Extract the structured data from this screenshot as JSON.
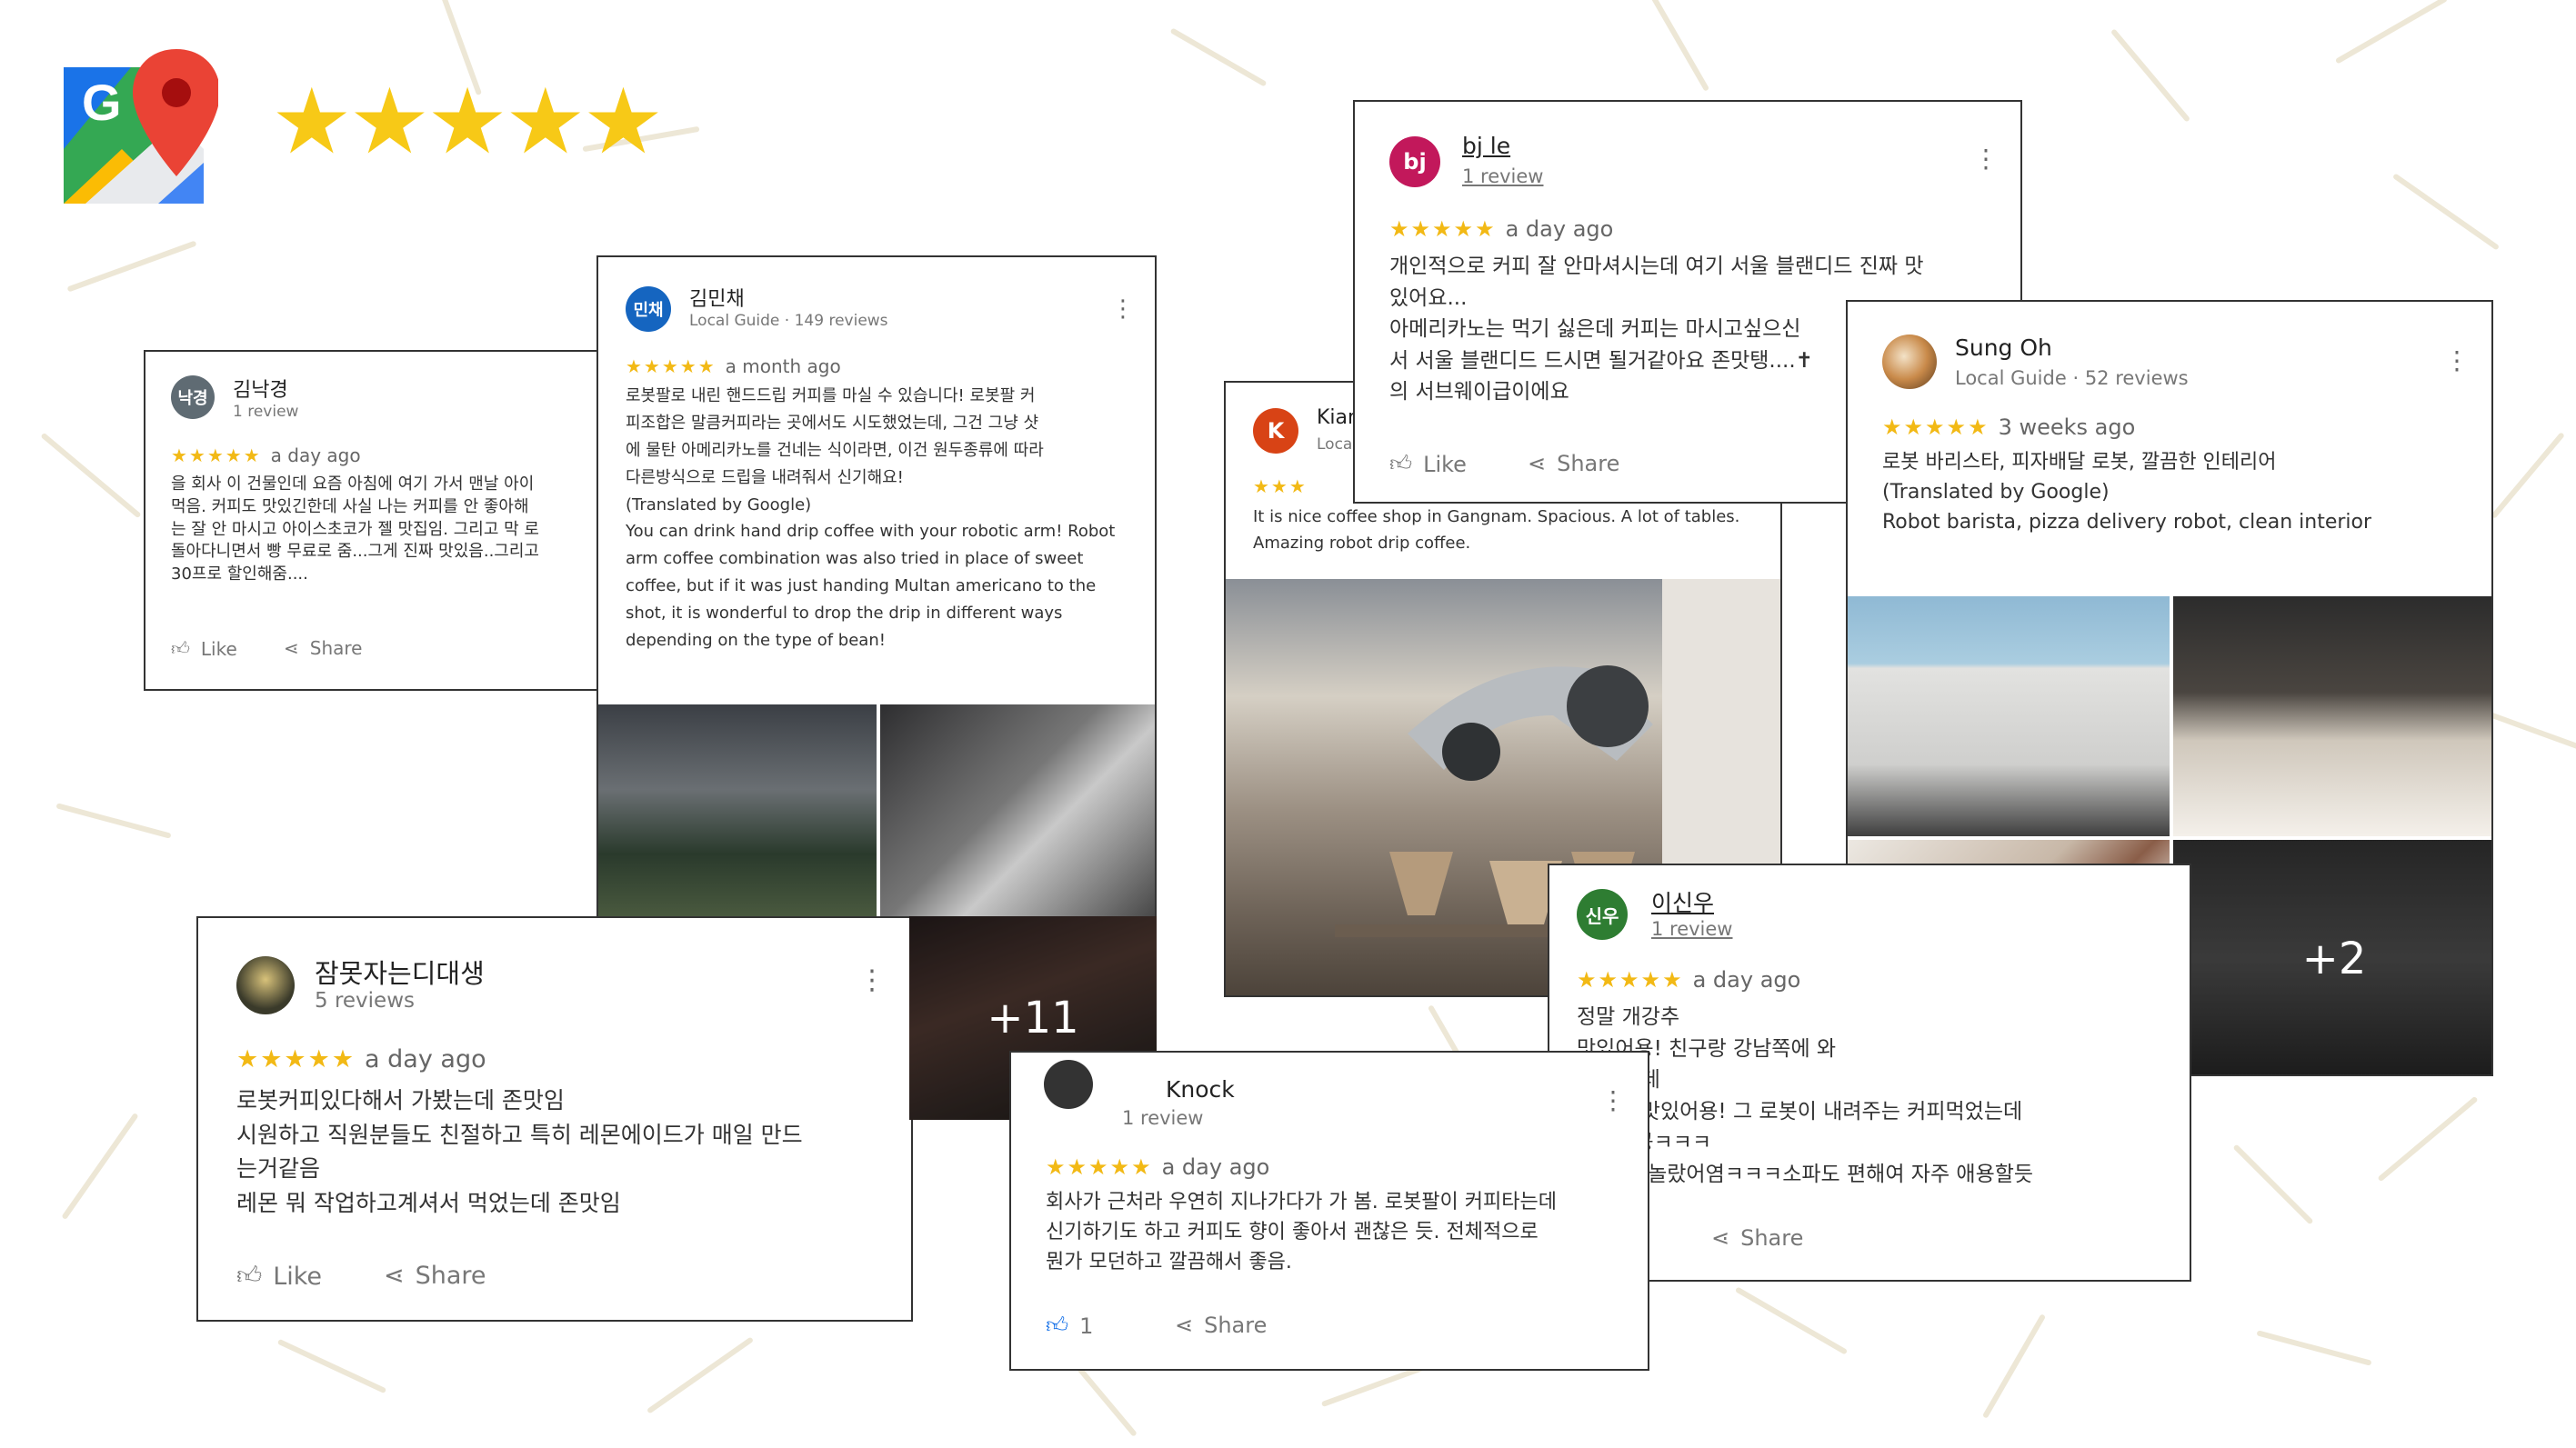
{
  "page": {
    "rating_stars": "★★★★★",
    "logo": "google-maps-logo-icon"
  },
  "colors": {
    "star": "#f7c917",
    "review_star": "#f2b915",
    "background_dash": "#ede7d6",
    "like_active": "#1a73e8"
  },
  "actions": {
    "like": "Like",
    "share": "Share"
  },
  "reviews": [
    {
      "avatar": "낙경",
      "avatar_color": "#5f6b73",
      "name": "김낙경",
      "meta": "1 review",
      "stars": "★★★★★",
      "time": "a day ago",
      "text": [
        "을 회사 이 건물인데 요즘 아침에 여기 가서 맨날 아이",
        "먹음. 커피도 맛있긴한데 사실 나는 커피를 안 좋아해",
        "는 잘 안 마시고 아이스초코가 젤 맛집임. 그리고 막 로",
        "돌아다니면서 빵 무료로 줌...그게 진짜 맛있음..그리고",
        "30프로 할인해줌...."
      ]
    },
    {
      "avatar": "민채",
      "avatar_color": "#1565c0",
      "name": "김민채",
      "meta_badge": "Local Guide",
      "meta": "· 149 reviews",
      "stars": "★★★★★",
      "time": "a month ago",
      "text": [
        "로봇팔로 내린 핸드드립 커피를 마실 수 있습니다! 로봇팔 커",
        "피조합은 말큼커피라는 곳에서도 시도했었는데, 그건 그냥 샷",
        "에 물탄 아메리카노를 건네는 식이라면, 이건 원두종류에 따라",
        "다른방식으로 드립을 내려줘서 신기해요!",
        "",
        "(Translated by Google)",
        "You can drink hand drip coffee with your robotic arm! Robot",
        "arm coffee combination was also tried in place of sweet",
        "coffee, but if it was just handing Multan americano to the",
        "shot, it is wonderful to drop the drip in different ways",
        "depending on the type of bean!"
      ],
      "photo_count": "+11"
    },
    {
      "avatar": "",
      "avatar_color": "#3a3a2a",
      "name": "잠못자는디대생",
      "meta": "5 reviews",
      "stars": "★★★★★",
      "time": "a day ago",
      "text": [
        "로봇커피있다해서 가봤는데 존맛임",
        "시원하고 직원분들도 친절하고 특히 레몬에이드가 매일 만드",
        "는거같음",
        "레몬 뭐 작업하고계셔서 먹었는데 존맛임"
      ]
    },
    {
      "avatar": "bj",
      "avatar_color": "#c2185b",
      "name": "bj le",
      "meta": "1 review",
      "stars": "★★★★★",
      "time": "a day ago",
      "text": [
        "개인적으로 커피 잘 안마셔시는데 여기 서울 블랜디드 진짜 맛",
        "있어요...",
        "아메리카노는 먹기 싫은데 커피는 마시고싶으신",
        "서 서울 블랜디드 드시면 될거같아요 존맛탱....✝",
        "의 서브웨이급이에요"
      ]
    },
    {
      "avatar": "K",
      "avatar_color": "#d84315",
      "name": "Kian",
      "meta": "Loca",
      "stars": "★★★",
      "time": "",
      "text": [
        "It is nice coffee shop in Gangnam. Spacious. A lot of tables.",
        "Amazing robot drip coffee."
      ]
    },
    {
      "avatar": "",
      "avatar_color": "#8a5a2b",
      "name": "Sung Oh",
      "meta_badge": "Local Guide",
      "meta": "· 52 reviews",
      "stars": "★★★★★",
      "time": "3 weeks ago",
      "text": [
        "로봇 바리스타, 피자배달 로봇, 깔끔한 인테리어",
        "",
        "(Translated by Google)",
        "Robot barista, pizza delivery robot, clean interior"
      ],
      "photo_count": "+2"
    },
    {
      "avatar": "신우",
      "avatar_color": "#2e7d32",
      "name": "이신우",
      "meta": "1 review",
      "stars": "★★★★★",
      "time": "a day ago",
      "text": [
        "정말 개강추",
        "맛있어용! 친구랑 강남쪽에 와",
        "가 갔는데",
        "커피도 맛있어용! 그 로봇이 내려주는 커피먹었는데",
        "기도하공ㅋㅋㅋ",
        "어서 더 놀랐어염ㅋㅋㅋ소파도 편해여 자주 애용할듯"
      ]
    },
    {
      "avatar": "",
      "avatar_color": "#333333",
      "name": "Knock",
      "meta": "1 review",
      "stars": "★★★★★",
      "time": "a day ago",
      "text": [
        "회사가 근처라 우연히 지나가다가 가 봄. 로봇팔이 커피타는데",
        "신기하기도 하고 커피도 향이 좋아서 괜찮은 듯. 전체적으로",
        "뭔가 모던하고 깔끔해서 좋음."
      ],
      "like_count": "1"
    }
  ]
}
